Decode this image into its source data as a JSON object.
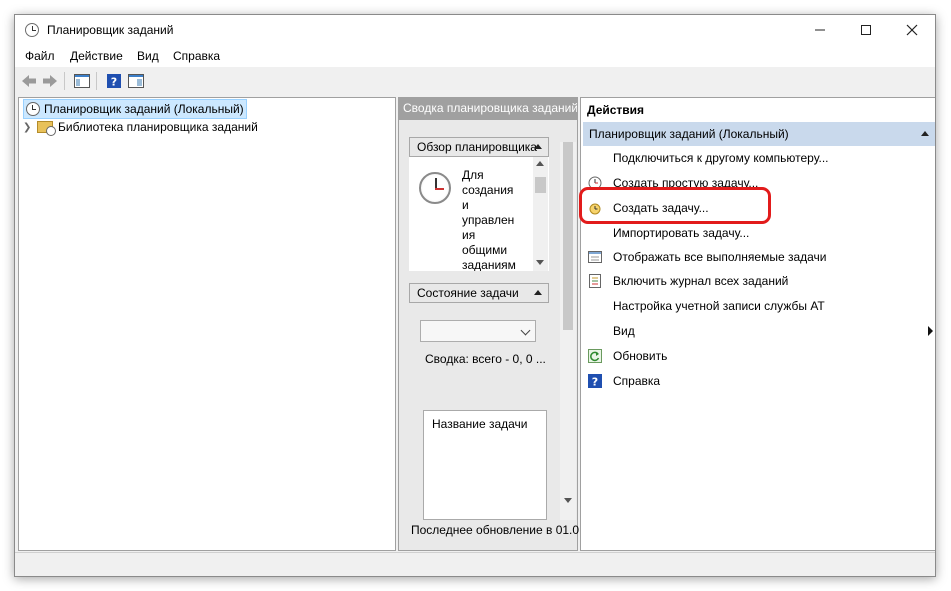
{
  "window": {
    "title": "Планировщик заданий"
  },
  "menu": [
    "Файл",
    "Действие",
    "Вид",
    "Справка"
  ],
  "tree": {
    "root": "Планировщик заданий (Локальный)",
    "child": "Библиотека планировщика заданий"
  },
  "middle": {
    "header": "Сводка планировщика заданий",
    "overview": {
      "label": "Обзор планировщика",
      "lines": [
        "Для",
        "создания",
        "и",
        "управлен",
        "ия",
        "общими",
        "заданиям"
      ]
    },
    "status": {
      "label": "Состояние задачи",
      "summary": "Сводка: всего - 0, 0 ...",
      "list_header": "Название задачи"
    },
    "last_update": "Последнее обновление в 01.0"
  },
  "actions": {
    "title": "Действия",
    "group": "Планировщик заданий (Локальный)",
    "items": [
      {
        "label": "Подключиться к другому компьютеру...",
        "icon": "none"
      },
      {
        "label": "Создать простую задачу...",
        "icon": "simple-task-icon"
      },
      {
        "label": "Создать задачу...",
        "icon": "create-task-icon"
      },
      {
        "label": "Импортировать задачу...",
        "icon": "none"
      },
      {
        "label": "Отображать все выполняемые задачи",
        "icon": "running-tasks-icon"
      },
      {
        "label": "Включить журнал всех заданий",
        "icon": "journal-icon"
      },
      {
        "label": "Настройка учетной записи службы AT",
        "icon": "none"
      },
      {
        "label": "Вид",
        "icon": "none",
        "submenu": true
      },
      {
        "label": "Обновить",
        "icon": "refresh-icon"
      },
      {
        "label": "Справка",
        "icon": "help-icon"
      }
    ]
  },
  "colors": {
    "highlight": "#e21b1b",
    "selection": "#cce8ff",
    "group_header": "#c9d9ec"
  }
}
